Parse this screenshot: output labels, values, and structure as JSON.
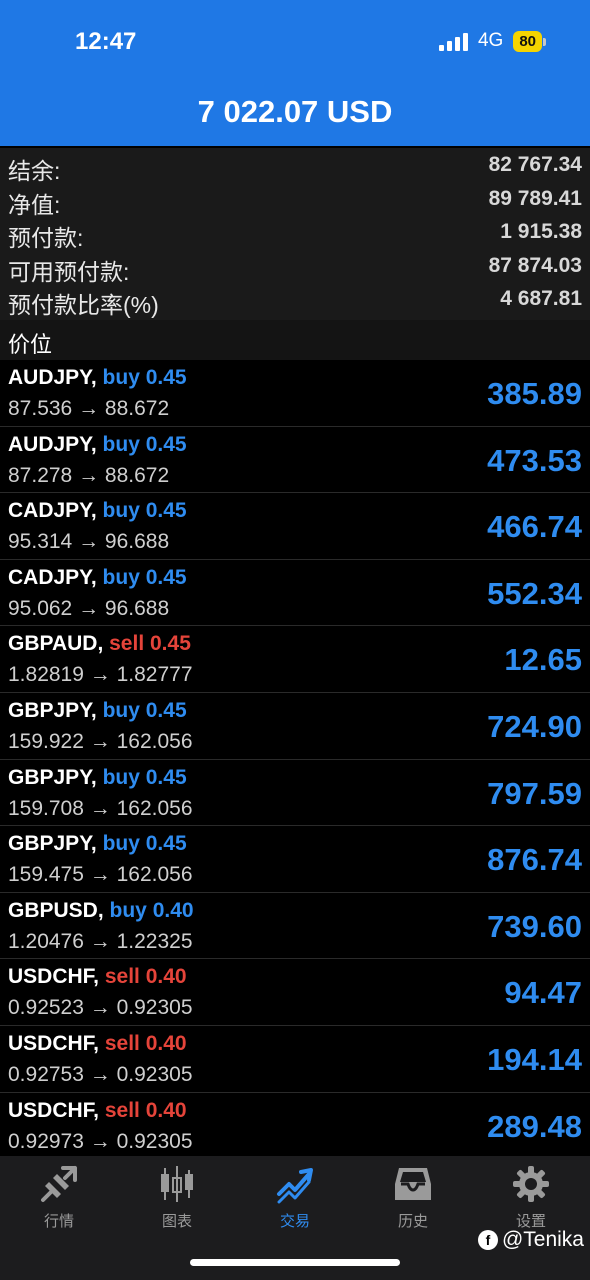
{
  "status_bar": {
    "time": "12:47",
    "network": "4G",
    "battery": "80"
  },
  "header": {
    "balance": "7 022.07 USD"
  },
  "summary": [
    {
      "label": "结余:",
      "value": "82 767.34"
    },
    {
      "label": "净值:",
      "value": "89 789.41"
    },
    {
      "label": "预付款:",
      "value": "1 915.38"
    },
    {
      "label": "可用预付款:",
      "value": "87 874.03"
    },
    {
      "label": "预付款比率(%)",
      "value": "4 687.81"
    }
  ],
  "section": {
    "label": "价位"
  },
  "trades": [
    {
      "symbol": "AUDJPY,",
      "side": "buy",
      "volume": "0.45",
      "open": "87.536",
      "current": "88.672",
      "profit": "385.89"
    },
    {
      "symbol": "AUDJPY,",
      "side": "buy",
      "volume": "0.45",
      "open": "87.278",
      "current": "88.672",
      "profit": "473.53"
    },
    {
      "symbol": "CADJPY,",
      "side": "buy",
      "volume": "0.45",
      "open": "95.314",
      "current": "96.688",
      "profit": "466.74"
    },
    {
      "symbol": "CADJPY,",
      "side": "buy",
      "volume": "0.45",
      "open": "95.062",
      "current": "96.688",
      "profit": "552.34"
    },
    {
      "symbol": "GBPAUD,",
      "side": "sell",
      "volume": "0.45",
      "open": "1.82819",
      "current": "1.82777",
      "profit": "12.65"
    },
    {
      "symbol": "GBPJPY,",
      "side": "buy",
      "volume": "0.45",
      "open": "159.922",
      "current": "162.056",
      "profit": "724.90"
    },
    {
      "symbol": "GBPJPY,",
      "side": "buy",
      "volume": "0.45",
      "open": "159.708",
      "current": "162.056",
      "profit": "797.59"
    },
    {
      "symbol": "GBPJPY,",
      "side": "buy",
      "volume": "0.45",
      "open": "159.475",
      "current": "162.056",
      "profit": "876.74"
    },
    {
      "symbol": "GBPUSD,",
      "side": "buy",
      "volume": "0.40",
      "open": "1.20476",
      "current": "1.22325",
      "profit": "739.60"
    },
    {
      "symbol": "USDCHF,",
      "side": "sell",
      "volume": "0.40",
      "open": "0.92523",
      "current": "0.92305",
      "profit": "94.47"
    },
    {
      "symbol": "USDCHF,",
      "side": "sell",
      "volume": "0.40",
      "open": "0.92753",
      "current": "0.92305",
      "profit": "194.14"
    },
    {
      "symbol": "USDCHF,",
      "side": "sell",
      "volume": "0.40",
      "open": "0.92973",
      "current": "0.92305",
      "profit": "289.48"
    }
  ],
  "tabs": [
    {
      "label": "行情",
      "icon": "quotes-icon",
      "active": false
    },
    {
      "label": "图表",
      "icon": "chart-icon",
      "active": false
    },
    {
      "label": "交易",
      "icon": "trade-icon",
      "active": true
    },
    {
      "label": "历史",
      "icon": "history-icon",
      "active": false
    },
    {
      "label": "设置",
      "icon": "settings-icon",
      "active": false
    }
  ],
  "watermark": "@Tenika",
  "colors": {
    "header": "#1f78e5",
    "buy": "#2f8cf0",
    "sell": "#e5443a",
    "profit": "#2f8cf0",
    "active_tab": "#2f8cf0"
  }
}
